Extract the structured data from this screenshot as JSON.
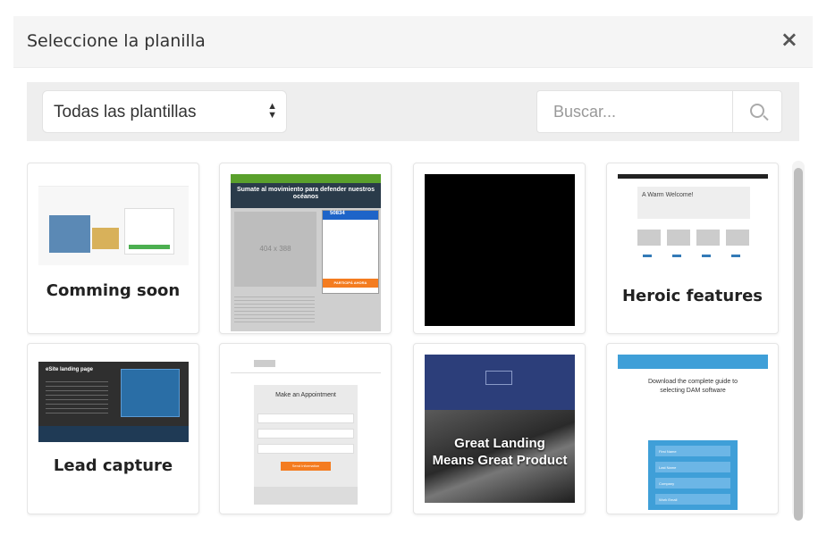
{
  "dialog": {
    "title": "Seleccione la planilla",
    "close_symbol": "×"
  },
  "filter": {
    "select_value": "Todas las plantillas",
    "search_placeholder": "Buscar..."
  },
  "icons": {
    "close": "close-icon",
    "search": "search-icon",
    "select_arrows": "sort-arrows-icon"
  },
  "templates": [
    {
      "label": "Comming soon"
    },
    {
      "label": ""
    },
    {
      "label": ""
    },
    {
      "label": "Heroic features"
    },
    {
      "label": "Lead capture"
    },
    {
      "label": ""
    },
    {
      "label": ""
    },
    {
      "label": ""
    }
  ],
  "thumbnails": {
    "greenpeace_heading": "Sumate al movimiento para defender nuestros océanos",
    "greenpeace_placeholder": "404 x 388",
    "greenpeace_count": "50834",
    "greenpeace_button": "PARTICIPÁ AHORA",
    "heroic_heading": "A Warm Welcome!",
    "appointment_heading": "Make an Appointment",
    "appointment_button": "Send Information",
    "landing_text_1": "Great Landing",
    "landing_text_2": "Means Great Product",
    "dam_text": "Download the complete guide to selecting DAM software",
    "dam_fields": [
      "First Name",
      "Last Name",
      "Company",
      "Work Email"
    ],
    "lead_heading": "eSite landing page"
  },
  "colors": {
    "header_bg": "#f5f5f5",
    "filter_bg": "#eeeeee",
    "greenpeace_green": "#5aa02c",
    "landing_blue": "#2c3e7a",
    "dam_blue": "#3f9fd8",
    "appointment_orange": "#f47c20"
  }
}
